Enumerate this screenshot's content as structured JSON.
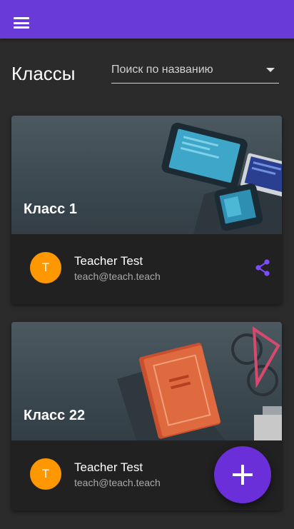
{
  "appbar": {
    "color": "#6a3ad8",
    "menu_icon": "menu-icon"
  },
  "page": {
    "title": "Классы",
    "search": {
      "placeholder": "Поиск по названию"
    }
  },
  "classes": [
    {
      "title": "Класс 1",
      "teacher": {
        "initial": "T",
        "name": "Teacher Test",
        "email": "teach@teach.teach"
      },
      "share_icon": "share-icon"
    },
    {
      "title": "Класс 22",
      "teacher": {
        "initial": "T",
        "name": "Teacher Test",
        "email": "teach@teach.teach"
      }
    }
  ],
  "fab": {
    "icon": "add-icon",
    "color": "#6a2fd8"
  },
  "colors": {
    "background": "#2b2b2b",
    "card": "#222222",
    "avatar": "#ff9800",
    "accent": "#7c4dff"
  }
}
